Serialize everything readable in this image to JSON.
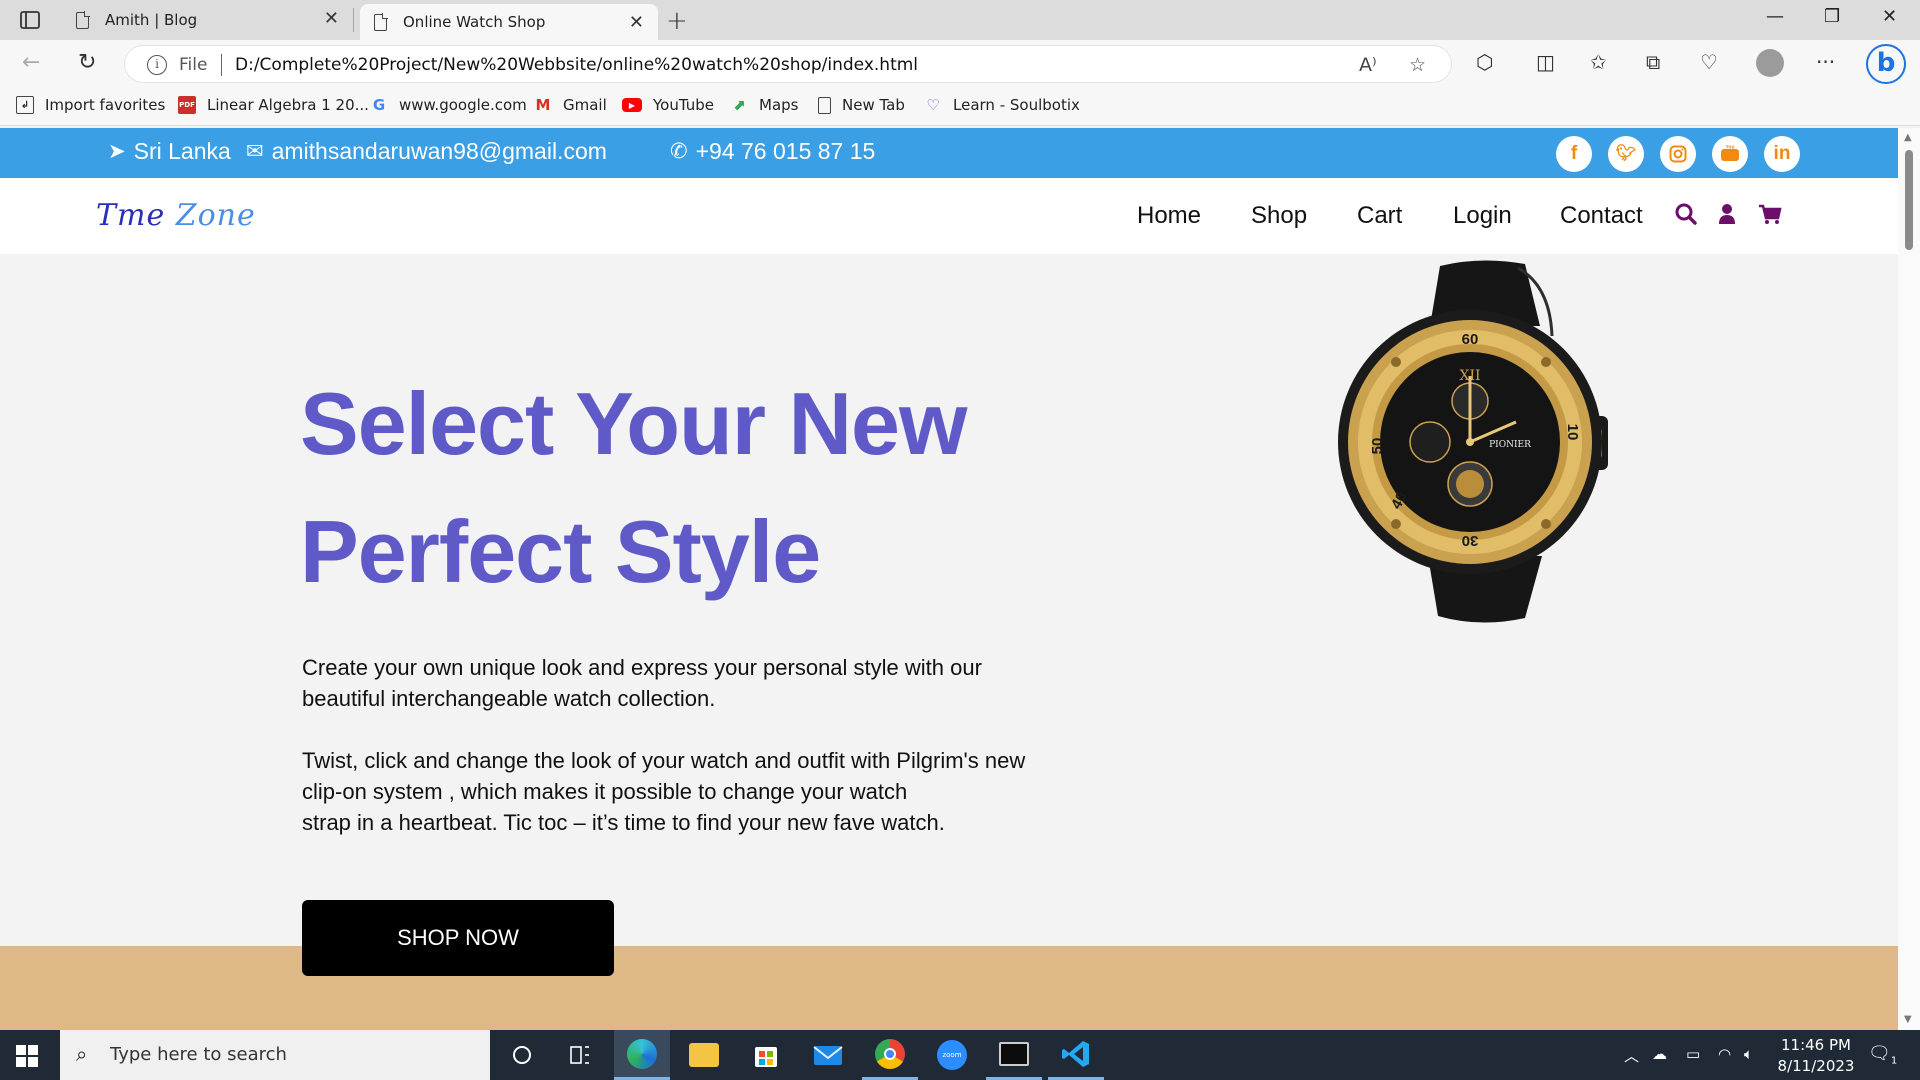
{
  "browser": {
    "tabs": [
      {
        "title": "Amith | Blog"
      },
      {
        "title": "Online Watch Shop"
      }
    ],
    "address": {
      "scheme_label": "File",
      "url": "D:/Complete%20Project/New%20Webbsite/online%20watch%20shop/index.html"
    },
    "bookmarks": [
      {
        "label": "Import favorites"
      },
      {
        "label": "Linear Algebra 1 20..."
      },
      {
        "label": "www.google.com"
      },
      {
        "label": "Gmail"
      },
      {
        "label": "YouTube"
      },
      {
        "label": "Maps"
      },
      {
        "label": "New Tab"
      },
      {
        "label": "Learn - Soulbotix"
      }
    ]
  },
  "page": {
    "topbar": {
      "location": "Sri Lanka",
      "email": "amithsandaruwan98@gmail.com",
      "phone": "+94 76 015 87 15",
      "social": [
        "f",
        "t",
        "ig",
        "yt",
        "in"
      ]
    },
    "logo": {
      "first": "Tme",
      "second": "Zone"
    },
    "nav": [
      "Home",
      "Shop",
      "Cart",
      "Login",
      "Contact"
    ],
    "hero": {
      "title_line1": "Select Your New",
      "title_line2": "Perfect Style",
      "para1_line1": "Create your own unique look and express your personal style with our",
      "para1_line2": "beautiful interchangeable watch collection.",
      "para2_line1": "Twist, click and change the look of your watch and outfit with Pilgrim's new",
      "para2_line2": "clip-on system , which makes it possible to change your watch",
      "para2_line3": "strap in a heartbeat. Tic toc – it’s time to find your new fave watch.",
      "button": "SHOP NOW",
      "watch_numerals": {
        "top": "60",
        "right": "10",
        "bottom": "30",
        "left": "50",
        "lower_left": "40",
        "xii": "XII",
        "brand": "PIONIER"
      }
    },
    "colors": {
      "topbar": "#3b9fe5",
      "hero_title": "#5f5ac8",
      "nav_icons": "#6b0f6b",
      "social_icon": "#f08a11",
      "band": "#dfb887"
    }
  },
  "taskbar": {
    "search_placeholder": "Type here to search",
    "time": "11:46 PM",
    "date": "8/11/2023",
    "notification_count": "1"
  }
}
